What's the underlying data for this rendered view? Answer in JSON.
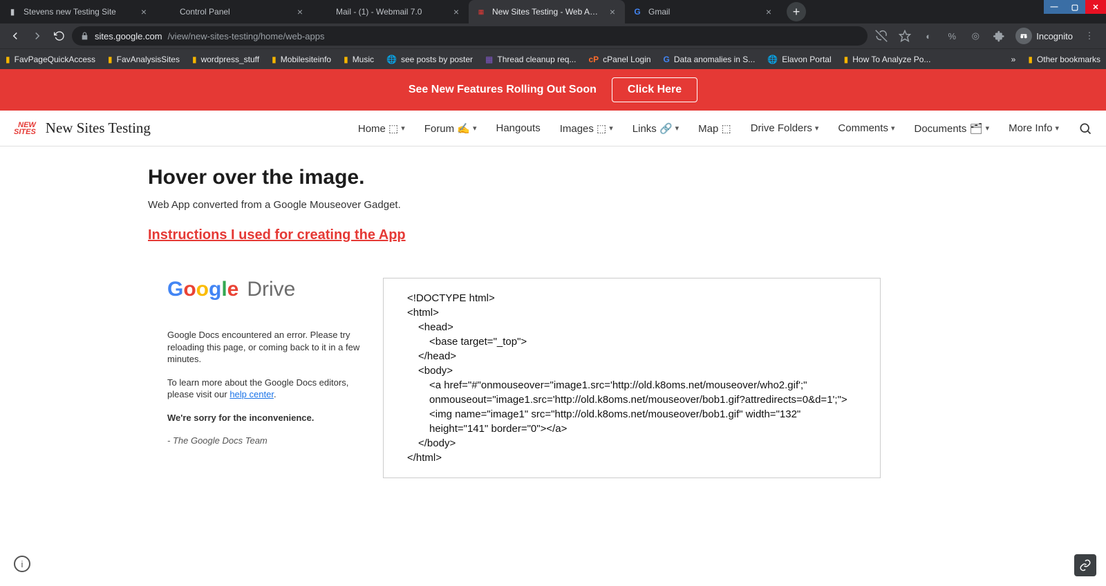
{
  "browser": {
    "tabs": [
      {
        "title": "Stevens new Testing Site",
        "active": false
      },
      {
        "title": "Control Panel",
        "active": false
      },
      {
        "title": "Mail - (1) - Webmail 7.0",
        "active": false
      },
      {
        "title": "New Sites Testing - Web Apps",
        "active": true
      },
      {
        "title": "Gmail",
        "active": false
      }
    ],
    "url_host": "sites.google.com",
    "url_path": "/view/new-sites-testing/home/web-apps",
    "incognito_label": "Incognito"
  },
  "bookmarks": [
    {
      "label": "FavPageQuickAccess",
      "icon": "folder"
    },
    {
      "label": "FavAnalysisSites",
      "icon": "folder"
    },
    {
      "label": "wordpress_stuff",
      "icon": "folder"
    },
    {
      "label": "Mobilesiteinfo",
      "icon": "folder"
    },
    {
      "label": "Music",
      "icon": "folder"
    },
    {
      "label": "see posts by poster",
      "icon": "globe"
    },
    {
      "label": "Thread cleanup req...",
      "icon": "app"
    },
    {
      "label": "cPanel Login",
      "icon": "cp"
    },
    {
      "label": "Data anomalies in S...",
      "icon": "g"
    },
    {
      "label": "Elavon Portal",
      "icon": "globe"
    },
    {
      "label": "How To Analyze Po...",
      "icon": "page"
    }
  ],
  "other_bookmarks": "Other bookmarks",
  "banner": {
    "text": "See New Features Rolling Out Soon",
    "button": "Click Here"
  },
  "site": {
    "logo_small_line1": "NEW",
    "logo_small_line2": "SITES",
    "name": "New Sites Testing",
    "nav": [
      {
        "label": "Home ⬚",
        "chev": true
      },
      {
        "label": "Forum ✍",
        "chev": true
      },
      {
        "label": "Hangouts",
        "chev": false
      },
      {
        "label": "Images ⬚",
        "chev": true
      },
      {
        "label": "Links 🔗",
        "chev": true
      },
      {
        "label": "Map ⬚",
        "chev": false
      },
      {
        "label": "Drive Folders",
        "chev": true
      },
      {
        "label": "Comments",
        "chev": true
      },
      {
        "label": "Documents 🗂",
        "chev": true
      },
      {
        "label": "More Info",
        "chev": true
      }
    ]
  },
  "page": {
    "heading": "Hover over the image.",
    "subtitle": "Web App converted from a Google Mouseover Gadget.",
    "instructions_link": "Instructions I used for creating the App"
  },
  "drive_error": {
    "p1": "Google Docs encountered an error. Please try reloading this page, or coming back to it in a few minutes.",
    "p2a": "To learn more about the Google Docs editors, please visit our ",
    "help_link": "help center",
    "sorry": "We're sorry for the inconvenience.",
    "team": "- The Google Docs Team"
  },
  "code": {
    "l1": "<!DOCTYPE html>",
    "l2": "<html>",
    "l3": "<head>",
    "l4": "<base target=\"_top\">",
    "l5": "</head>",
    "l6": "<body>",
    "l7": "<a href=\"#\"onmouseover=\"image1.src='http://old.k8oms.net/mouseover/who2.gif';\" onmouseout=\"image1.src='http://old.k8oms.net/mouseover/bob1.gif?attredirects=0&d=1';\"> <img name=\"image1\" src=\"http://old.k8oms.net/mouseover/bob1.gif\" width=\"132\" height=\"141\" border=\"0\"></a>",
    "l8": "</body>",
    "l9": "</html>"
  }
}
